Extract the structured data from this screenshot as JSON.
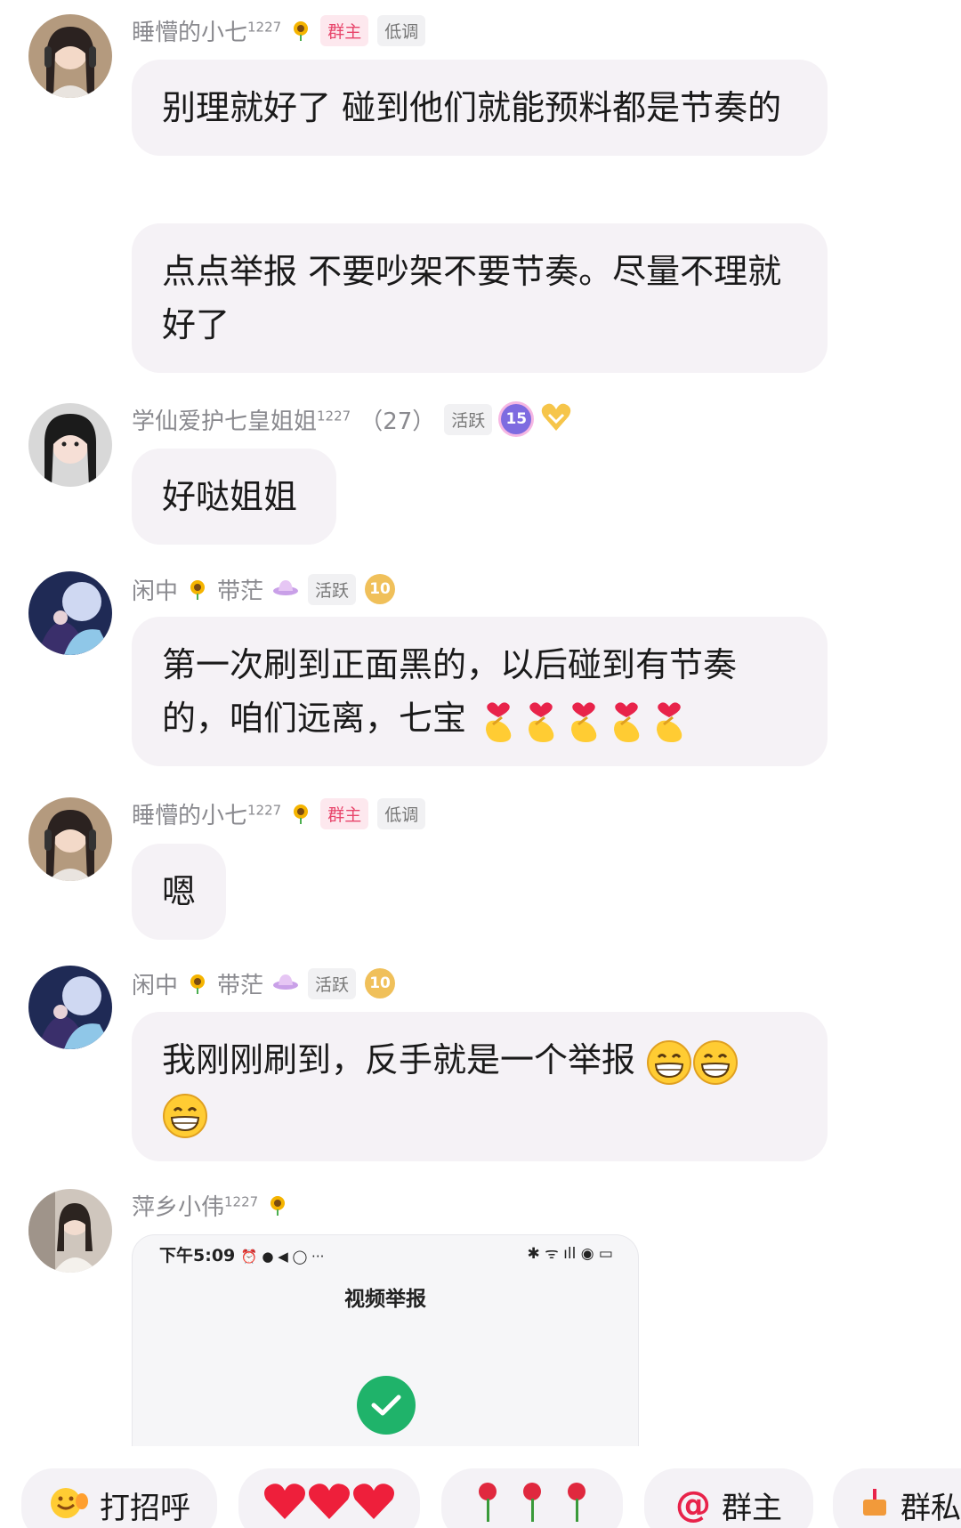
{
  "messages": [
    {
      "user": "睡懵的小七",
      "user_sup": "1227",
      "badges": [
        "群主",
        "低调"
      ],
      "bubbles": [
        "别理就好了 碰到他们就能预料都是节奏的",
        "点点举报 不要吵架不要节奏。尽量不理就好了"
      ]
    },
    {
      "user": "学仙爱护七皇姐姐",
      "user_sup": "1227",
      "extra": "（27）",
      "badges": [
        "活跃"
      ],
      "level": "15",
      "bubbles": [
        "好哒姐姐"
      ]
    },
    {
      "user_a": "闲中",
      "user_b": "带茫",
      "badges": [
        "活跃"
      ],
      "level": "10",
      "bubbles": [
        "第一次刷到正面黑的，以后碰到有节奏的，咱们远离，七宝"
      ],
      "emojis": "finger-heart-emoji x5"
    },
    {
      "user": "睡懵的小七",
      "user_sup": "1227",
      "badges": [
        "群主",
        "低调"
      ],
      "bubbles": [
        "嗯"
      ]
    },
    {
      "user_a": "闲中",
      "user_b": "带茫",
      "badges": [
        "活跃"
      ],
      "level": "10",
      "bubbles": [
        "我刚刚刷到，反手就是一个举报"
      ],
      "emojis": "grin-emoji x3"
    },
    {
      "user": "萍乡小伟",
      "user_sup": "1227",
      "screenshot": {
        "status_time": "下午5:09",
        "status_icons": "⏰ ● ◀ ◯ ···",
        "status_right": "✱ ᯤ ıll ◉ ▭",
        "title": "视频举报"
      }
    }
  ],
  "quick_replies": [
    {
      "label": "打招呼",
      "icon": "wave-emoji"
    },
    {
      "label": "",
      "icon": "hearts-emoji"
    },
    {
      "label": "",
      "icon": "roses-emoji"
    },
    {
      "label": "群主",
      "icon": "at-icon"
    },
    {
      "label": "群私",
      "icon": "cake-emoji"
    }
  ],
  "colors": {
    "bubble": "#f5f2f6",
    "owner_badge": "#e8456b",
    "check": "#1fb36a"
  }
}
